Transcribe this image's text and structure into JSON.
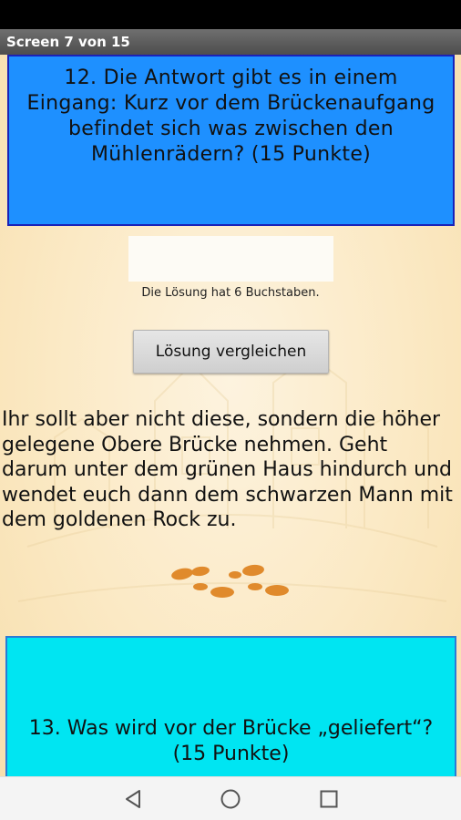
{
  "header": {
    "title": "Screen 7 von 15"
  },
  "question_12": {
    "text": "12. Die Antwort gibt es in einem Eingang: Kurz vor dem Brückenaufgang befindet sich was zwischen den Mühlenrädern? (15 Punkte)"
  },
  "answer": {
    "value": "",
    "placeholder": "",
    "hint": "Die Lösung hat 6 Buchstaben."
  },
  "compare_button": {
    "label": "Lösung vergleichen"
  },
  "story": {
    "text": "Ihr sollt aber nicht diese, sondern die höher gelegene Obere Brücke nehmen. Geht darum unter dem grünen Haus hindurch und wendet euch dann dem schwarzen Mann mit dem goldenen Rock zu."
  },
  "question_13": {
    "text": "13. Was wird vor der Brücke „geliefert“? (15 Punkte)"
  },
  "colors": {
    "question_12_bg": "#1e90ff",
    "question_13_bg": "#00e5f2",
    "footprints": "#e08a2c"
  },
  "icons": {
    "footprints": "footprints-icon",
    "back": "back-triangle-icon",
    "home": "home-circle-icon",
    "recents": "recents-square-icon"
  }
}
